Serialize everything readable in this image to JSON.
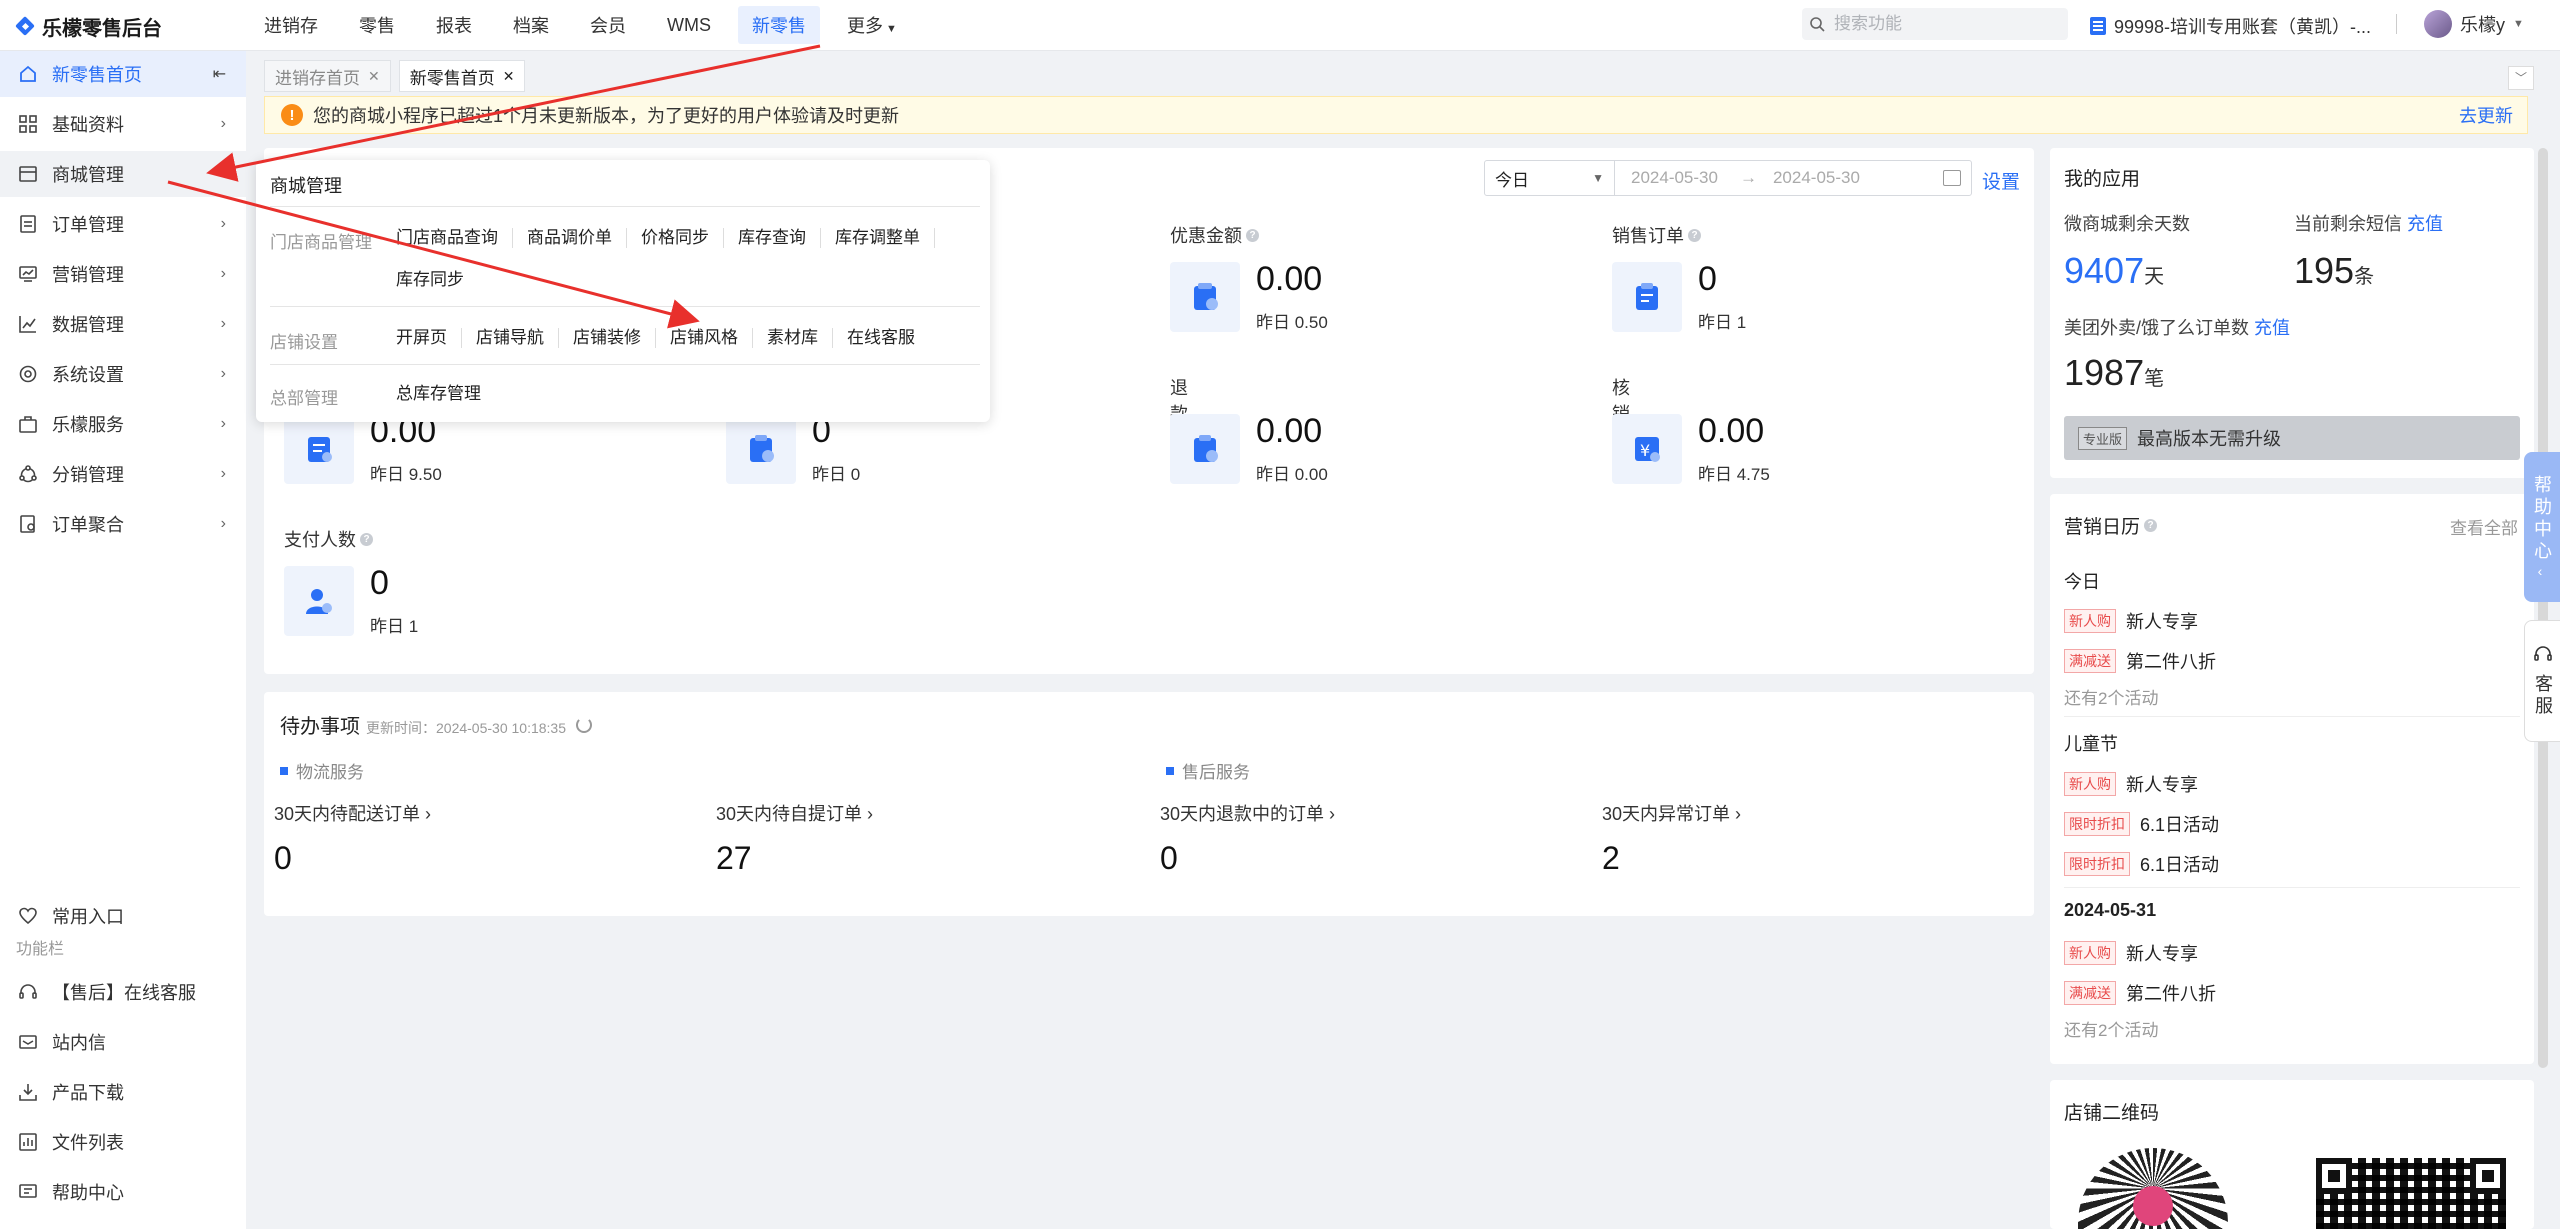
{
  "app": {
    "logo": "乐檬零售后台"
  },
  "topnav": [
    {
      "label": "进销存"
    },
    {
      "label": "零售"
    },
    {
      "label": "报表"
    },
    {
      "label": "档案"
    },
    {
      "label": "会员"
    },
    {
      "label": "WMS"
    },
    {
      "label": "新零售",
      "active": true
    },
    {
      "label": "更多"
    }
  ],
  "search": {
    "placeholder": "搜索功能"
  },
  "account": {
    "label": "99998-培训专用账套（黄凯）-..."
  },
  "user": {
    "name": "乐檬y"
  },
  "sidebar": {
    "items": [
      {
        "label": "新零售首页",
        "icon": "home-icon"
      },
      {
        "label": "基础资料",
        "icon": "grid-icon"
      },
      {
        "label": "商城管理",
        "icon": "shop-icon"
      },
      {
        "label": "订单管理",
        "icon": "order-icon"
      },
      {
        "label": "营销管理",
        "icon": "marketing-icon"
      },
      {
        "label": "数据管理",
        "icon": "chart-icon"
      },
      {
        "label": "系统设置",
        "icon": "settings-icon"
      },
      {
        "label": "乐檬服务",
        "icon": "service-icon"
      },
      {
        "label": "分销管理",
        "icon": "distribution-icon"
      },
      {
        "label": "订单聚合",
        "icon": "aggregate-icon"
      }
    ],
    "bottom": {
      "favorites": "常用入口",
      "section_label": "功能栏",
      "items": [
        {
          "label": "【售后】在线客服",
          "icon": "headset-icon"
        },
        {
          "label": "站内信",
          "icon": "mail-icon"
        },
        {
          "label": "产品下载",
          "icon": "download-icon"
        },
        {
          "label": "文件列表",
          "icon": "file-list-icon"
        },
        {
          "label": "帮助中心",
          "icon": "help-icon"
        }
      ]
    }
  },
  "tabs": [
    {
      "label": "进销存首页"
    },
    {
      "label": "新零售首页",
      "active": true
    }
  ],
  "notice": {
    "text": "您的商城小程序已超过1个月未更新版本，为了更好的用户体验请及时更新",
    "action": "去更新"
  },
  "dashboard": {
    "date_select": "今日",
    "date_start": "2024-05-30",
    "date_end": "2024-05-30",
    "settings": "设置",
    "metrics": [
      {
        "label": "优惠金额",
        "value": "0.00",
        "sub": "昨日 0.50"
      },
      {
        "label": "销售订单",
        "value": "0",
        "sub": "昨日 1"
      },
      {
        "label": "",
        "value": "0.00",
        "sub": "昨日 9.50"
      },
      {
        "label": "",
        "value": "0",
        "sub": "昨日 0"
      },
      {
        "label": "退款金额",
        "value": "0.00",
        "sub": "昨日 0.00"
      },
      {
        "label": "核销金额",
        "value": "0.00",
        "sub": "昨日 4.75"
      },
      {
        "label": "支付人数",
        "value": "0",
        "sub": "昨日 1"
      }
    ]
  },
  "popup": {
    "title": "商城管理",
    "groups": [
      {
        "category": "门店商品管理",
        "links": [
          "门店商品查询",
          "商品调价单",
          "价格同步",
          "库存查询",
          "库存调整单",
          "库存同步"
        ]
      },
      {
        "category": "店铺设置",
        "links": [
          "开屏页",
          "店铺导航",
          "店铺装修",
          "店铺风格",
          "素材库",
          "在线客服"
        ]
      },
      {
        "category": "总部管理",
        "links": [
          "总库存管理"
        ]
      }
    ]
  },
  "todo": {
    "title": "待办事项",
    "updated": "更新时间：2024-05-30 10:18:35",
    "sections": [
      "物流服务",
      "售后服务"
    ],
    "items": [
      {
        "label": "30天内待配送订单",
        "value": "0"
      },
      {
        "label": "30天内待自提订单",
        "value": "27"
      },
      {
        "label": "30天内退款中的订单",
        "value": "0"
      },
      {
        "label": "30天内异常订单",
        "value": "2"
      }
    ]
  },
  "apps": {
    "title": "我的应用",
    "mall_days_label": "微商城剩余天数",
    "mall_days": "9407",
    "mall_days_unit": "天",
    "sms_label": "当前剩余短信",
    "sms_recharge": "充值",
    "sms": "195",
    "sms_unit": "条",
    "takeout_label": "美团外卖/饿了么订单数",
    "takeout_recharge": "充值",
    "takeout": "1987",
    "takeout_unit": "笔",
    "edition_badge": "专业版",
    "edition_text": "最高版本无需升级"
  },
  "calendar": {
    "title": "营销日历",
    "view_all": "查看全部",
    "groups": [
      {
        "date": "今日",
        "events": [
          {
            "tag": "新人购",
            "name": "新人专享"
          },
          {
            "tag": "满减送",
            "name": "第二件八折"
          }
        ],
        "more": "还有2个活动"
      },
      {
        "date": "儿童节",
        "events": [
          {
            "tag": "新人购",
            "name": "新人专享"
          },
          {
            "tag": "限时折扣",
            "name": "6.1日活动"
          },
          {
            "tag": "限时折扣",
            "name": "6.1日活动"
          }
        ]
      },
      {
        "date": "2024-05-31",
        "events": [
          {
            "tag": "新人购",
            "name": "新人专享"
          },
          {
            "tag": "满减送",
            "name": "第二件八折"
          }
        ],
        "more": "还有2个活动"
      }
    ]
  },
  "qrcode": {
    "title": "店铺二维码"
  },
  "side_tabs": {
    "help": "帮助中心",
    "service": "客服"
  },
  "colors": {
    "accent": "#2a6ff5",
    "annotation": "#e8302c",
    "warning": "#fa8c16"
  }
}
